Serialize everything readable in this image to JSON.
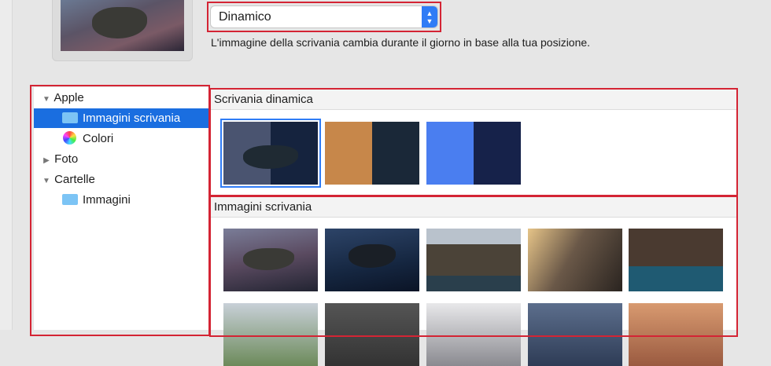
{
  "popup": {
    "value": "Dinamico"
  },
  "description": "L'immagine della scrivania cambia durante il giorno in base alla tua posizione.",
  "sidebar": {
    "items": [
      {
        "label": "Apple",
        "type": "group",
        "expanded": true
      },
      {
        "label": "Immagini scrivania",
        "type": "folder",
        "selected": true
      },
      {
        "label": "Colori",
        "type": "colors"
      },
      {
        "label": "Foto",
        "type": "group",
        "expanded": false
      },
      {
        "label": "Cartelle",
        "type": "group",
        "expanded": true
      },
      {
        "label": "Immagini",
        "type": "folder"
      }
    ]
  },
  "sections": {
    "dynamic": {
      "title": "Scrivania dinamica"
    },
    "desktop": {
      "title": "Immagini scrivania"
    }
  },
  "colors": {
    "accent": "#1a6ee0",
    "highlight": "#d42434"
  }
}
